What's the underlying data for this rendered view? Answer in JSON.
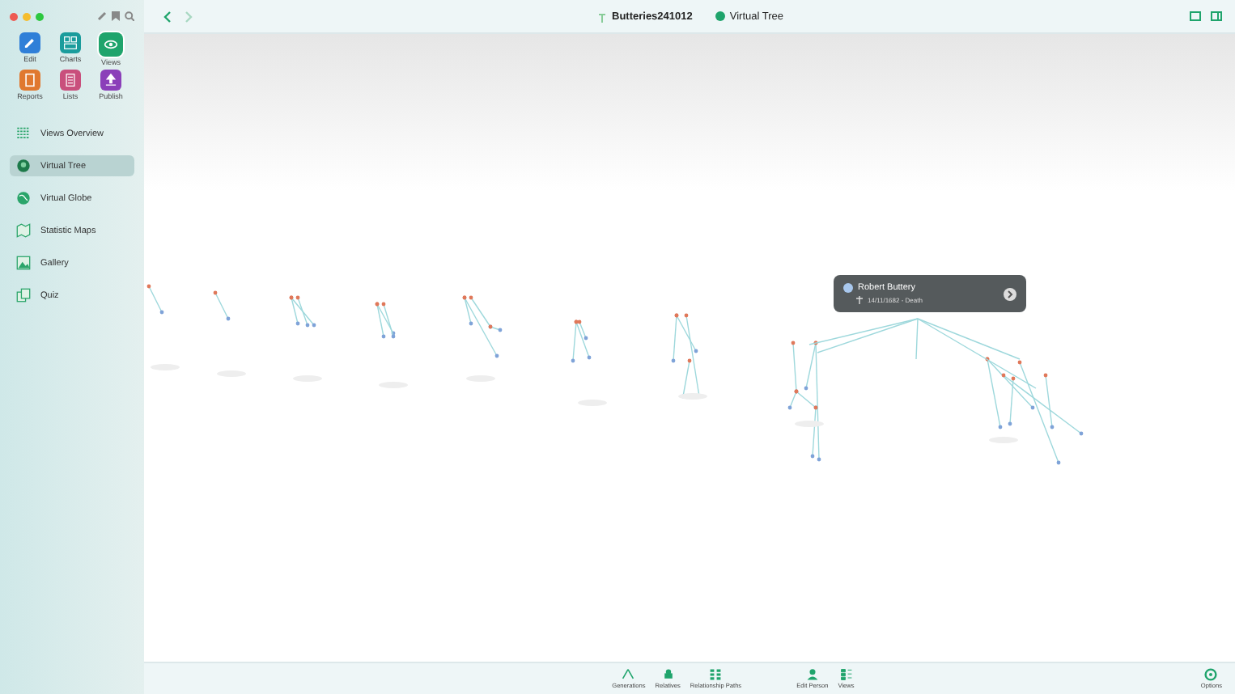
{
  "sidebar": {
    "apps": [
      {
        "label": "Edit",
        "color": "#2f7fd8",
        "selected": false
      },
      {
        "label": "Charts",
        "color": "#1b9c9c",
        "selected": false
      },
      {
        "label": "Views",
        "color": "#1fa46c",
        "selected": true
      },
      {
        "label": "Reports",
        "color": "#e0782f",
        "selected": false
      },
      {
        "label": "Lists",
        "color": "#c94f7c",
        "selected": false
      },
      {
        "label": "Publish",
        "color": "#8b3fb9",
        "selected": false
      }
    ],
    "items": [
      {
        "label": "Views Overview",
        "selected": false
      },
      {
        "label": "Virtual Tree",
        "selected": true
      },
      {
        "label": "Virtual Globe",
        "selected": false
      },
      {
        "label": "Statistic Maps",
        "selected": false
      },
      {
        "label": "Gallery",
        "selected": false
      },
      {
        "label": "Quiz",
        "selected": false
      }
    ]
  },
  "toolbar": {
    "document": "Butteries241012",
    "view": "Virtual Tree"
  },
  "popup": {
    "name": "Robert Buttery",
    "event": "14/11/1682 - Death"
  },
  "bottom_bar": {
    "buttons": [
      {
        "label": "Generations"
      },
      {
        "label": "Relatives"
      },
      {
        "label": "Relationship Paths"
      },
      {
        "label": "Edit Person"
      },
      {
        "label": "Views"
      }
    ],
    "options": "Options"
  }
}
